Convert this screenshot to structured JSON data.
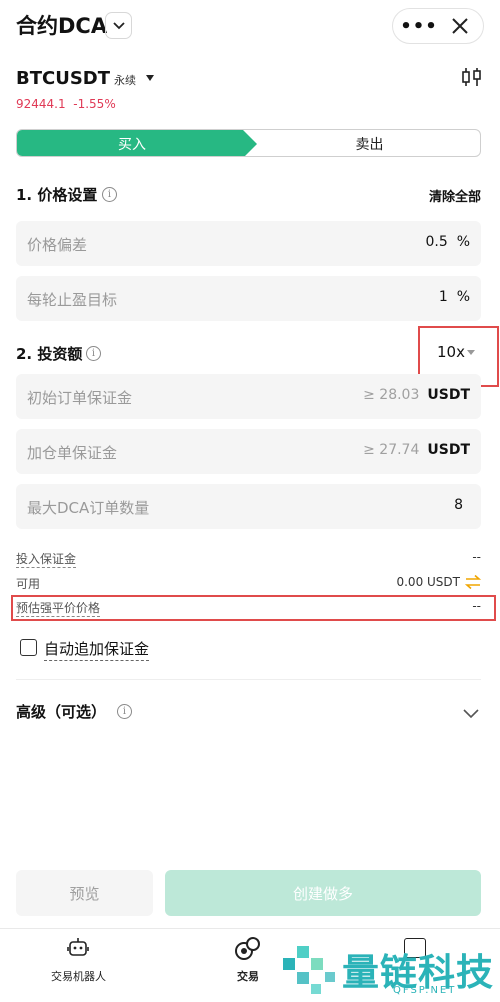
{
  "header": {
    "title": "合约DCA",
    "more_label": "•••"
  },
  "symbol": {
    "name": "BTCUSDT",
    "type": "永续",
    "price": "92444.1",
    "change": "-1.55%"
  },
  "toggle": {
    "buy": "买入",
    "sell": "卖出"
  },
  "price_settings": {
    "title": "1. 价格设置",
    "clear_all": "清除全部",
    "fields": [
      {
        "label": "价格偏差",
        "value": "0.5",
        "unit": "%"
      },
      {
        "label": "每轮止盈目标",
        "value": "1",
        "unit": "%"
      }
    ]
  },
  "investment": {
    "title": "2. 投资额",
    "leverage": "10x",
    "fields": [
      {
        "label": "初始订单保证金",
        "hint": "≥ 28.03",
        "unit": "USDT"
      },
      {
        "label": "加仓单保证金",
        "hint": "≥ 27.74",
        "unit": "USDT"
      },
      {
        "label": "最大DCA订单数量",
        "value": "8"
      }
    ]
  },
  "summary": {
    "invested_margin_label": "投入保证金",
    "invested_margin_value": "--",
    "available_label": "可用",
    "available_value": "0.00 USDT",
    "est_liq_label": "预估强平价价格",
    "est_liq_value": "--"
  },
  "auto_margin_label": "自动追加保证金",
  "advanced_label": "高级（可选）",
  "buttons": {
    "preview": "预览",
    "create": "创建做多"
  },
  "tabbar": [
    {
      "label": "交易机器人"
    },
    {
      "label": "交易"
    }
  ],
  "watermark": {
    "text": "量链科技",
    "sub": "QFSP.NET"
  },
  "colors": {
    "buy": "#27b883",
    "negative": "#e03a56",
    "highlight_box": "#e04b4b",
    "swap_icon": "#f0a500",
    "watermark": "#2bb3b8"
  }
}
